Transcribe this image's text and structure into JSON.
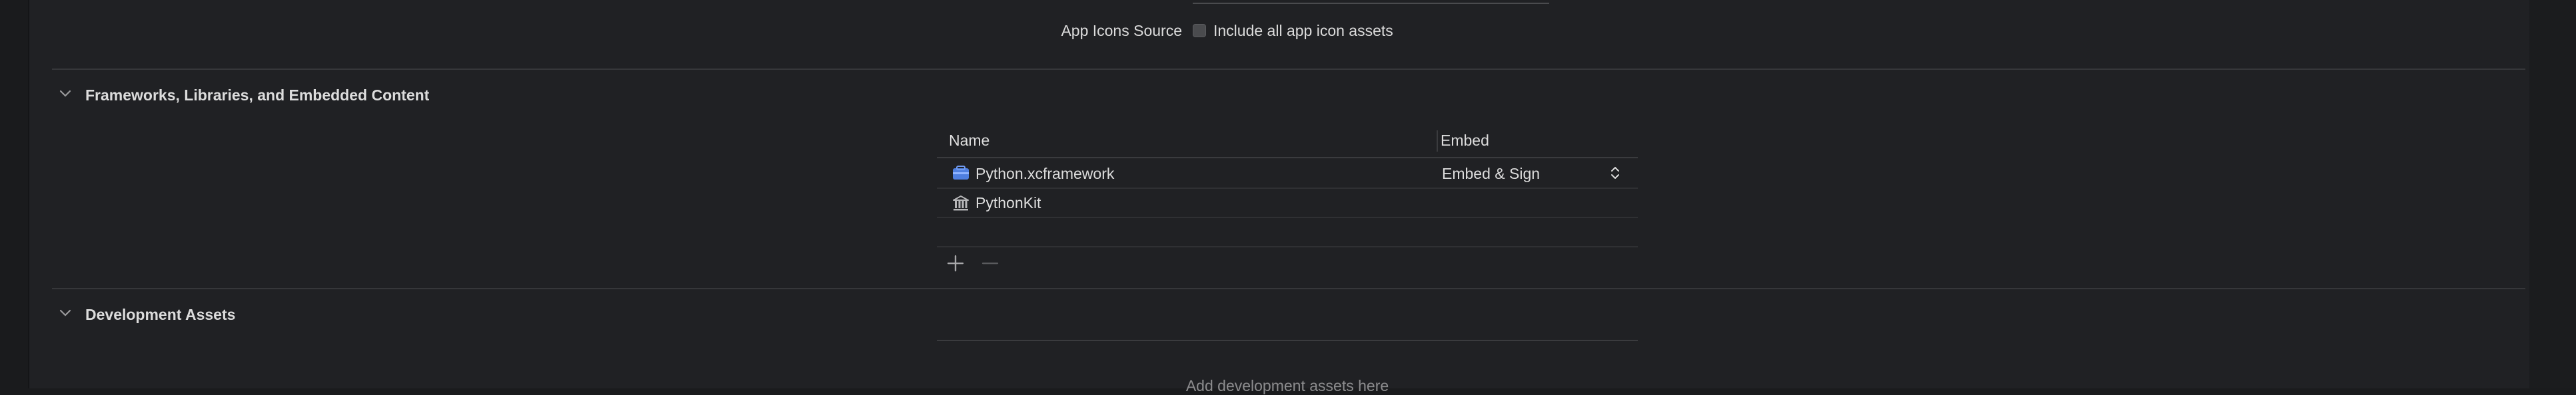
{
  "top": {
    "app_icons_source_label": "App Icons Source",
    "include_assets_label": "Include all app icon assets",
    "include_assets_checked": false
  },
  "frameworks": {
    "section_title": "Frameworks, Libraries, and Embedded Content",
    "columns": {
      "name": "Name",
      "embed": "Embed"
    },
    "rows": [
      {
        "name": "Python.xcframework",
        "icon": "xcframework-icon",
        "embed": "Embed & Sign"
      },
      {
        "name": "PythonKit",
        "icon": "library-icon",
        "embed": ""
      }
    ],
    "add_label": "+",
    "remove_label": "—"
  },
  "dev_assets": {
    "section_title": "Development Assets",
    "placeholder": "Add development assets here"
  },
  "colors": {
    "background": "#202124",
    "text": "#dcdcdc",
    "muted": "#8c8c8e",
    "icon_blue": "#5b8def"
  }
}
